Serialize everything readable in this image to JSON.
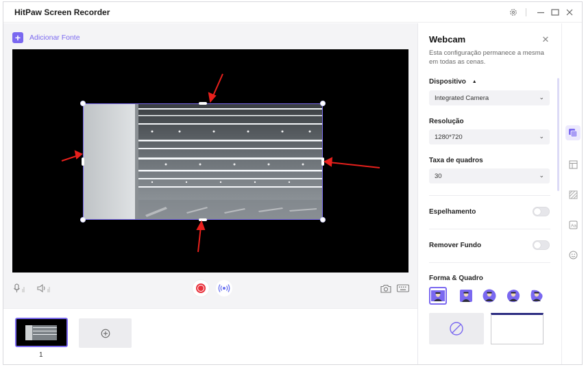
{
  "app": {
    "title": "HitPaw Screen Recorder"
  },
  "window_controls": [
    "settings-icon",
    "minimize-icon",
    "maximize-icon",
    "close-icon"
  ],
  "toolbar": {
    "add_source_label": "Adicionar Fonte"
  },
  "scenes": [
    {
      "number": "1"
    }
  ],
  "panel": {
    "title": "Webcam",
    "description": "Esta configuração permanece a mesma em todas as cenas.",
    "device": {
      "label": "Dispositivo",
      "value": "Integrated Camera"
    },
    "resolution": {
      "label": "Resolução",
      "value": "1280*720"
    },
    "framerate": {
      "label": "Taxa de quadros",
      "value": "30"
    },
    "mirror": {
      "label": "Espelhamento",
      "enabled": false
    },
    "remove_bg": {
      "label": "Remover Fundo",
      "enabled": false
    },
    "shape_frame": {
      "label": "Forma & Quadro"
    }
  },
  "colors": {
    "accent": "#7a68f0",
    "record": "#e8303a",
    "arrow": "#e8201c"
  }
}
